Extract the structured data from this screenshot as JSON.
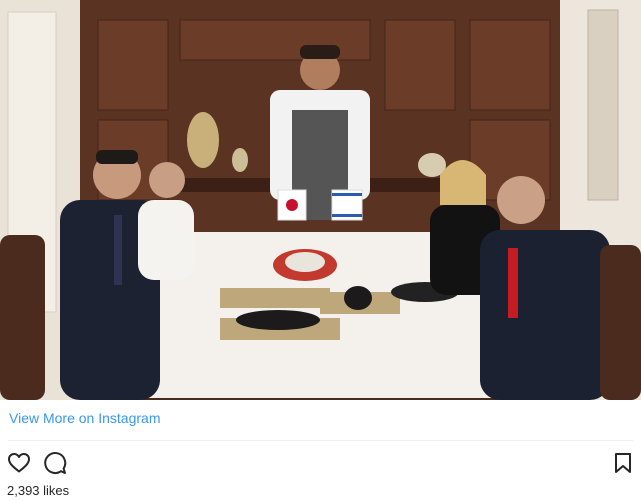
{
  "embed": {
    "photo_alt": "",
    "view_more_link": "View More on Instagram",
    "likes_text": "2,393 likes"
  },
  "icons": {
    "like": "heart-outline-icon",
    "comment": "comment-bubble-icon",
    "save": "bookmark-icon"
  },
  "colors": {
    "link": "#3897f0",
    "text": "#262626",
    "divider": "#efefef"
  }
}
